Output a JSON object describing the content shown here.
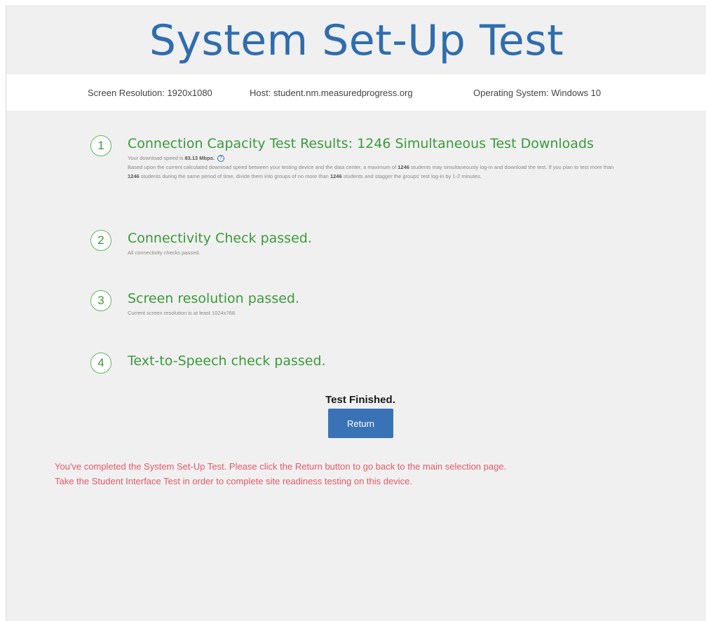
{
  "page": {
    "title": "System Set-Up Test"
  },
  "info_bar": {
    "screen_resolution": "Screen Resolution: 1920x1080",
    "host": "Host: student.nm.measuredprogress.org",
    "operating_system": "Operating System: Windows 10"
  },
  "steps": [
    {
      "number": "1",
      "title": "Connection Capacity Test Results: 1246 Simultaneous Test Downloads",
      "speed_prefix": "Your download speed is ",
      "speed_value": "83.13 Mbps.",
      "help_icon": "question-circle-icon",
      "body_parts": {
        "p1": "Based upon the current calculated download speed between your testing device and the data center, a maximum of ",
        "n1": "1246",
        "p2": " students may simultaneously log-in and download the test. If you plan to test more than ",
        "n2": "1246",
        "p3": " students during the same period of time, divide them into groups of no more than ",
        "n3": "1246",
        "p4": " students and stagger the groups' test log-in by 1-2 minutes."
      }
    },
    {
      "number": "2",
      "title": "Connectivity Check passed.",
      "subtitle": "All connectivity checks passed."
    },
    {
      "number": "3",
      "title": "Screen resolution passed.",
      "subtitle": "Current screen resolution is at least 1024x768."
    },
    {
      "number": "4",
      "title": "Text-to-Speech check passed."
    }
  ],
  "finished_label": "Test Finished.",
  "return_button": "Return",
  "notice": {
    "line1": "You've completed the System Set-Up Test. Please click the Return button to go back to the main selection page.",
    "line2": "Take the Student Interface Test in order to complete site readiness testing on this device."
  },
  "colors": {
    "title_blue": "#2f6dad",
    "success_green": "#3a9a3a",
    "button_blue": "#3a73b5",
    "notice_red": "#e05a6a"
  }
}
